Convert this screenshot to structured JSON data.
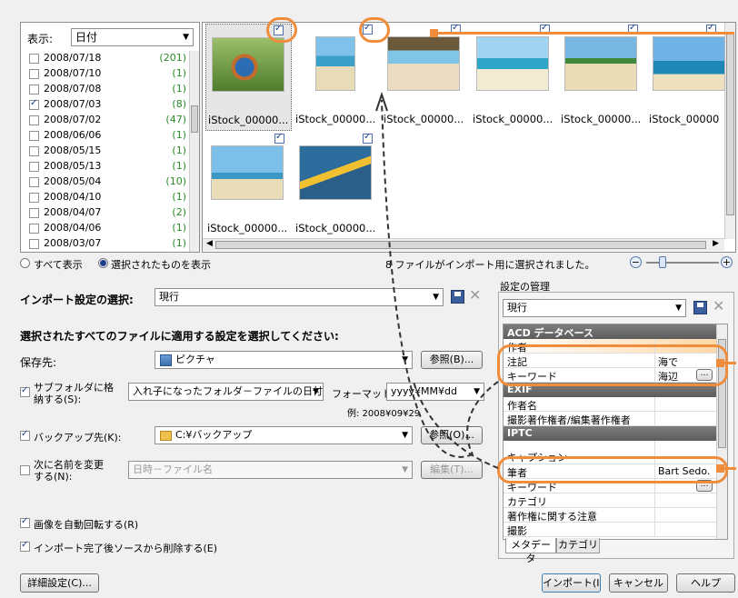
{
  "filter": {
    "label": "表示:",
    "value": "日付"
  },
  "dates": [
    {
      "date": "2008/07/18",
      "count": "(201)",
      "checked": false
    },
    {
      "date": "2008/07/10",
      "count": "(1)",
      "checked": false
    },
    {
      "date": "2008/07/08",
      "count": "(1)",
      "checked": false
    },
    {
      "date": "2008/07/03",
      "count": "(8)",
      "checked": true
    },
    {
      "date": "2008/07/02",
      "count": "(47)",
      "checked": false
    },
    {
      "date": "2008/06/06",
      "count": "(1)",
      "checked": false
    },
    {
      "date": "2008/05/15",
      "count": "(1)",
      "checked": false
    },
    {
      "date": "2008/05/13",
      "count": "(1)",
      "checked": false
    },
    {
      "date": "2008/05/04",
      "count": "(10)",
      "checked": false
    },
    {
      "date": "2008/04/10",
      "count": "(1)",
      "checked": false
    },
    {
      "date": "2008/04/07",
      "count": "(2)",
      "checked": false
    },
    {
      "date": "2008/04/06",
      "count": "(1)",
      "checked": false
    },
    {
      "date": "2008/03/07",
      "count": "(1)",
      "checked": false
    }
  ],
  "thumbs": [
    "iStock_00000...",
    "iStock_00000...",
    "iStock_00000...",
    "iStock_00000...",
    "iStock_00000...",
    "iStock_00000",
    "iStock_00000...",
    "iStock_00000..."
  ],
  "view": {
    "show_all": "すべて表示",
    "show_selected": "選択されたものを表示",
    "status": "8 ファイルがインポート用に選択されました。"
  },
  "import_settings": {
    "label": "インポート設定の選択:",
    "value": "現行"
  },
  "apply_heading": "選択されたすべてのファイルに適用する設定を選択してください:",
  "save_to": {
    "label": "保存先:",
    "value": "ピクチャ",
    "browse": "参照(B)..."
  },
  "subfolder": {
    "label_line1": "サブフォルダに格",
    "label_line2": "納する(S):",
    "value": "入れ子になったフォルダ－ファイルの日付",
    "format_label": "フォーマット:",
    "format_value": "yyyy¥MM¥dd",
    "example": "例: 2008¥09¥29"
  },
  "backup": {
    "label": "バックアップ先(K):",
    "value": "C:¥バックアップ",
    "browse": "参照(O)..."
  },
  "rename": {
    "label_line1": "次に名前を変更",
    "label_line2": "する(N):",
    "value": "日時－ファイル名",
    "edit": "編集(T)..."
  },
  "auto_rotate": "画像を自動回転する(R)",
  "delete_after": "インポート完了後ソースから削除する(E)",
  "advanced": "詳細設定(C)...",
  "manage": {
    "title": "設定の管理",
    "value": "現行"
  },
  "props": {
    "acd": "ACD データベース",
    "author": "作者",
    "note": "注記",
    "note_value": "海で",
    "keyword": "キーワード",
    "keyword_value": "海辺",
    "exif": "EXIF",
    "author_name": "作者名",
    "copyright": "撮影著作権者/編集著作権者",
    "iptc": "IPTC",
    "caption": "キャプション",
    "writer": "筆者",
    "writer_value": "Bart Sedo...",
    "keyword2": "キーワード",
    "category": "カテゴリ",
    "copyright_note": "著作権に関する注意",
    "photo": "撮影"
  },
  "tabs": [
    "メタデータ",
    "カテゴリ"
  ],
  "buttons": {
    "import": "インポート(I)",
    "cancel": "キャンセル",
    "help": "ヘルプ"
  },
  "accent_color": "#f08d3c"
}
